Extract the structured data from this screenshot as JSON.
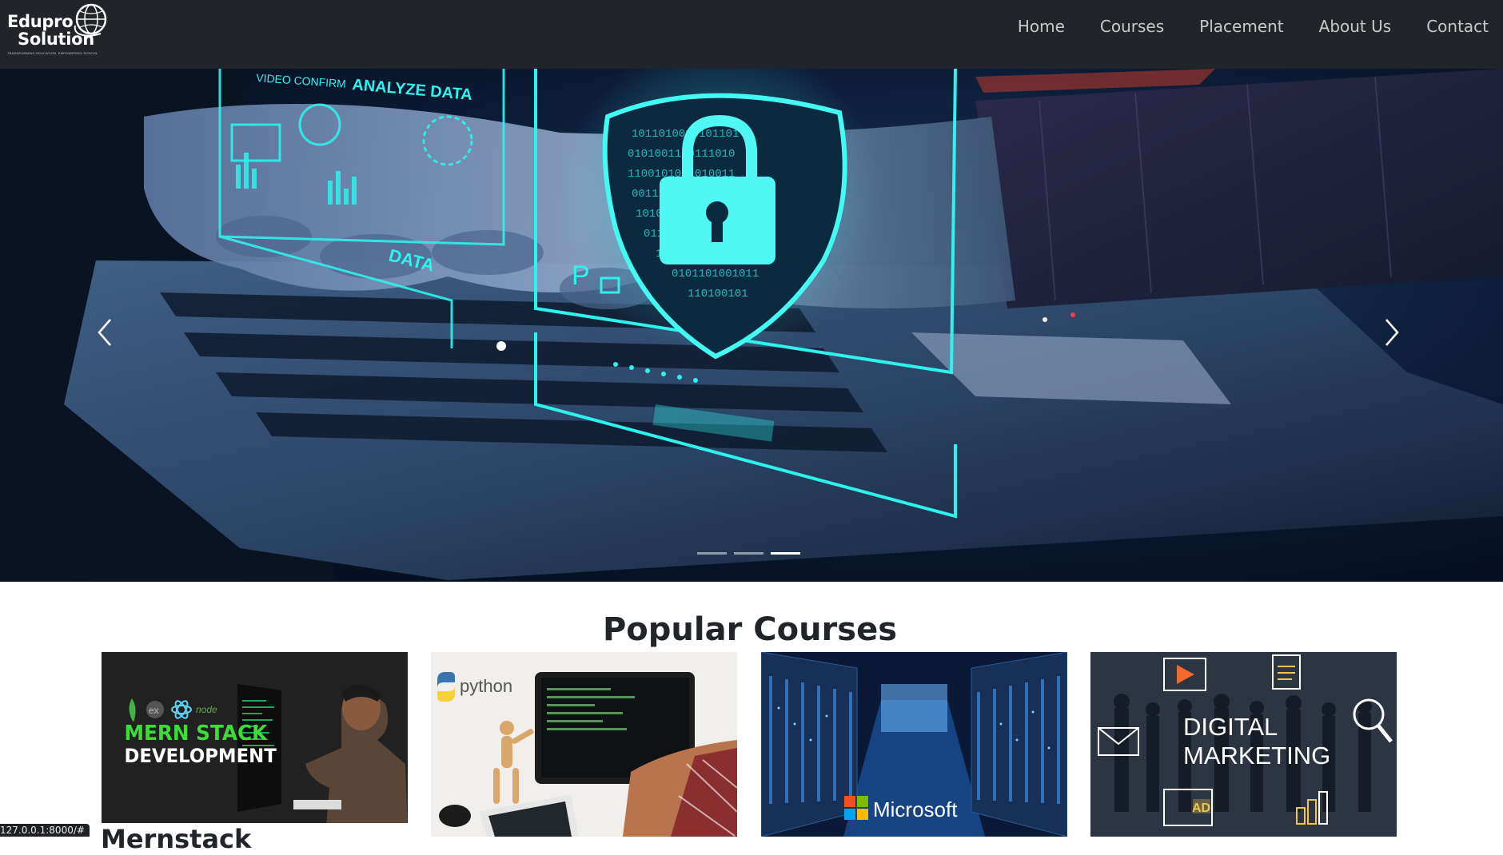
{
  "brand": {
    "name_line1": "Edupro",
    "name_line2": "Solution",
    "tagline": "TRANSFORMING EDUCATION, EMPOWERING SCHOOL",
    "logo_icon": "globe-emblem-icon"
  },
  "nav": {
    "items": [
      {
        "label": "Home"
      },
      {
        "label": "Courses"
      },
      {
        "label": "Placement"
      },
      {
        "label": "About Us"
      },
      {
        "label": "Contact"
      }
    ]
  },
  "carousel": {
    "slide_texts": {
      "hud_top_left": "VIDEO CONFIRM",
      "hud_top": "ANALYZE DATA",
      "hud_data": "DATA",
      "hud_pin": "P"
    },
    "prev_icon": "chevron-left-icon",
    "next_icon": "chevron-right-icon",
    "indicator_count": 3,
    "active_indicator": 3
  },
  "courses_section": {
    "title": "Popular Courses",
    "cards": [
      {
        "image_line1": "MERN STACK",
        "image_line2": "DEVELOPMENT",
        "image_logos": [
          "ex",
          "node"
        ],
        "title": "Mernstack"
      },
      {
        "image_logo_text": "python"
      },
      {
        "image_logo_text": "Microsoft"
      },
      {
        "image_line1": "DIGITAL",
        "image_line2": "MARKETING",
        "image_badge": "AD"
      }
    ]
  },
  "status_bar": {
    "url": "127.0.0.1:8000/#"
  },
  "colors": {
    "navbar_bg": "#212529",
    "accent_cyan": "#2ef2ee",
    "mern_green": "#3ddc3a"
  }
}
